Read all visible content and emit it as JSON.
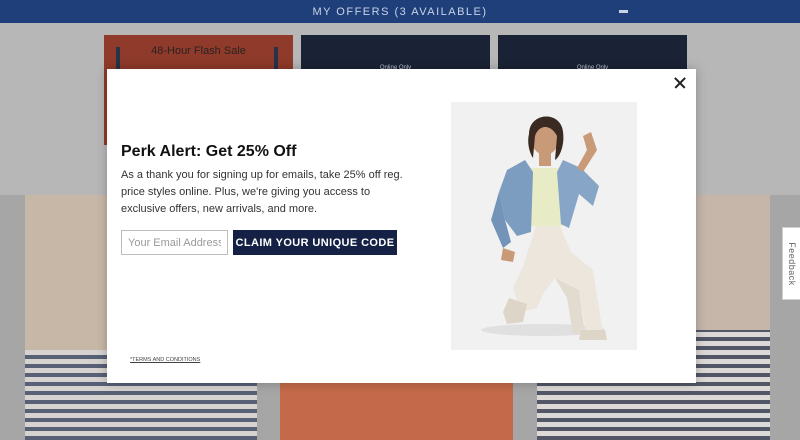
{
  "offers_bar": {
    "label": "MY OFFERS (3 AVAILABLE)"
  },
  "background": {
    "promo_red_label": "48-Hour Flash Sale",
    "promo_navy_1_label": "Online Only",
    "promo_navy_2_label": "Online Only"
  },
  "feedback_tab": {
    "label": "Feedback"
  },
  "modal": {
    "title": "Perk Alert: Get 25% Off",
    "body": "As a thank you for signing up for emails, take 25% off reg. price styles online. Plus, we're giving you access to exclusive offers, new arrivals, and more.",
    "email_placeholder": "Your Email Address",
    "email_value": "",
    "cta_label": "CLAIM YOUR UNIQUE CODE",
    "terms_label": "*TERMS AND CONDITIONS"
  },
  "colors": {
    "offers_bar": "#1f3f7a",
    "cta_background": "#142145"
  },
  "icons": {
    "close": "close-icon",
    "toggle": "minus-icon"
  }
}
